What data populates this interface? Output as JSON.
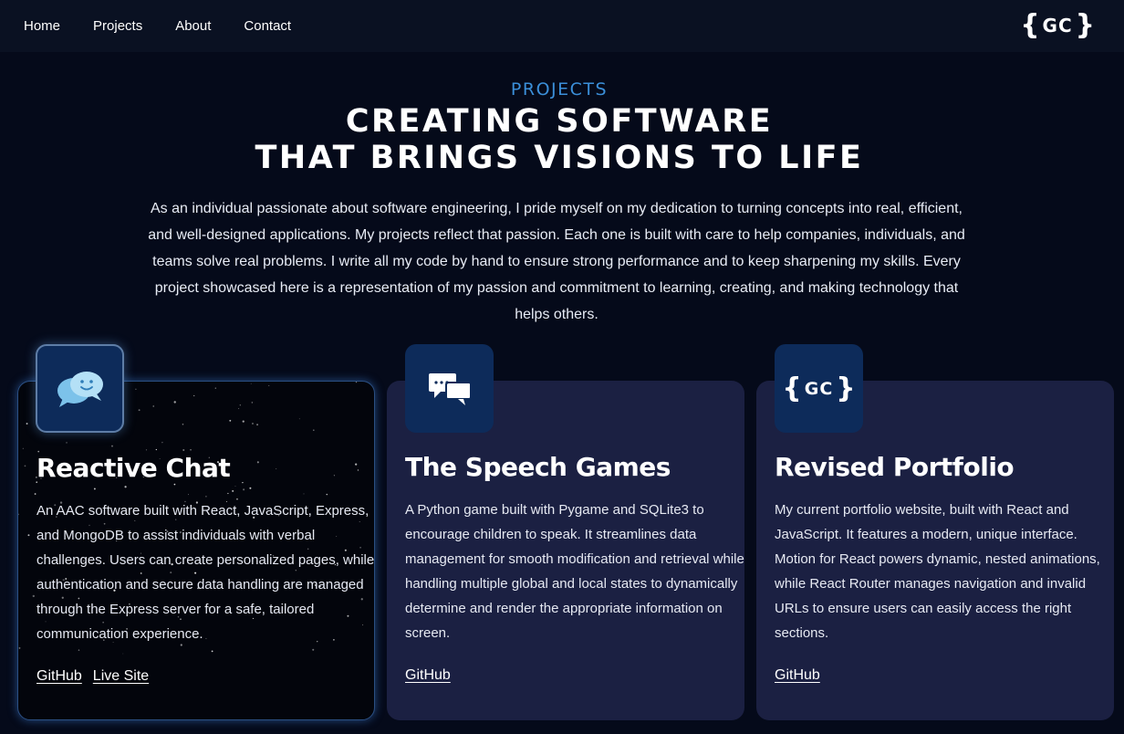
{
  "nav": {
    "items": [
      {
        "label": "Home"
      },
      {
        "label": "Projects"
      },
      {
        "label": "About"
      },
      {
        "label": "Contact"
      }
    ],
    "logo": {
      "left_brace": "{",
      "letters": "GC",
      "right_brace": "}"
    }
  },
  "hero": {
    "eyebrow": "PROJECTS",
    "headline_line1": "CREATING SOFTWARE",
    "headline_line2": "THAT BRINGS VISIONS TO LIFE",
    "intro": "As an individual passionate about software engineering, I pride myself on my dedication to turning concepts into real, efficient, and well-designed applications. My projects reflect that passion. Each one is built with care to help companies, individuals, and teams solve real problems. I write all my code by hand to ensure strong performance and to keep sharpening my skills. Every project showcased here is a representation of my passion and commitment to learning, creating, and making technology that helps others."
  },
  "projects": [
    {
      "title": "Reactive Chat",
      "icon": "chat-bubbles-icon",
      "description": "An AAC software built with React, JavaScript, Express, and MongoDB to assist individuals with verbal challenges. Users can create personalized pages, while authentication and secure data handling are managed through the Express server for a safe, tailored communication experience.",
      "links": [
        {
          "label": "GitHub"
        },
        {
          "label": "Live Site"
        }
      ]
    },
    {
      "title": "The Speech Games",
      "icon": "speech-bubbles-icon",
      "description": "A Python game built with Pygame and SQLite3 to encourage children to speak. It streamlines data management for smooth modification and retrieval while handling multiple global and local states to dynamically determine and render the appropriate information on screen.",
      "links": [
        {
          "label": "GitHub"
        }
      ]
    },
    {
      "title": "Revised Portfolio",
      "icon": "gc-logo-icon",
      "tile_logo": {
        "left_brace": "{",
        "letters": "GC",
        "right_brace": "}"
      },
      "description": "My current portfolio website, built with React and JavaScript. It features a modern, unique interface. Motion for React powers dynamic, nested animations, while React Router manages navigation and invalid URLs to ensure users can easily access the right sections.",
      "links": [
        {
          "label": "GitHub"
        }
      ]
    }
  ],
  "colors": {
    "page_bg": "#050a1a",
    "nav_bg": "#0a1122",
    "accent": "#3b8fd9",
    "card_bg": "#1b2042",
    "icon_tile_bg": "#0d2b5a",
    "active_card_bg": "#03050c"
  }
}
